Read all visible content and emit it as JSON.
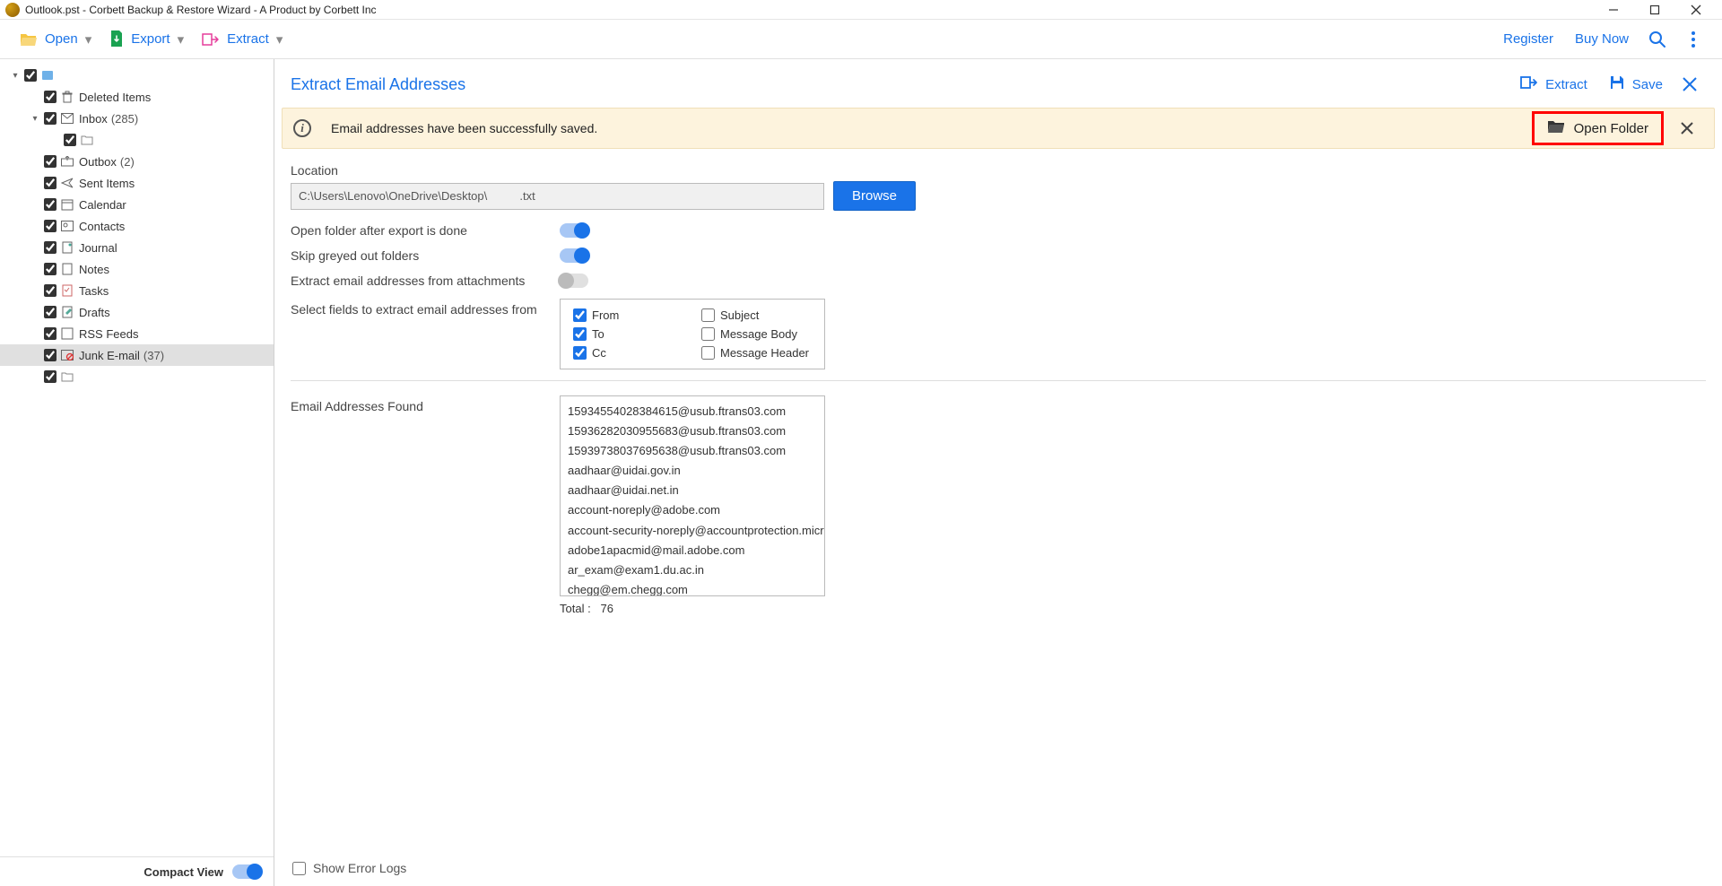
{
  "titlebar": {
    "title": "Outlook.pst - Corbett Backup & Restore Wizard - A Product by Corbett Inc"
  },
  "toolbar": {
    "open": "Open",
    "export": "Export",
    "extract": "Extract",
    "register": "Register",
    "buy_now": "Buy Now"
  },
  "tree": {
    "root_label": "",
    "items": [
      {
        "level": 0,
        "expand": "▾",
        "checked": true,
        "icon": "pst",
        "label": "",
        "count": ""
      },
      {
        "level": 1,
        "expand": "",
        "checked": true,
        "icon": "trash",
        "label": "Deleted Items",
        "count": ""
      },
      {
        "level": 1,
        "expand": "▾",
        "checked": true,
        "icon": "mail",
        "label": "Inbox",
        "count": "(285)"
      },
      {
        "level": 2,
        "expand": "",
        "checked": true,
        "icon": "folder",
        "label": "",
        "count": ""
      },
      {
        "level": 1,
        "expand": "",
        "checked": true,
        "icon": "outbox",
        "label": "Outbox",
        "count": "(2)"
      },
      {
        "level": 1,
        "expand": "",
        "checked": true,
        "icon": "sent",
        "label": "Sent Items",
        "count": ""
      },
      {
        "level": 1,
        "expand": "",
        "checked": true,
        "icon": "calendar",
        "label": "Calendar",
        "count": ""
      },
      {
        "level": 1,
        "expand": "",
        "checked": true,
        "icon": "contacts",
        "label": "Contacts",
        "count": ""
      },
      {
        "level": 1,
        "expand": "",
        "checked": true,
        "icon": "journal",
        "label": "Journal",
        "count": ""
      },
      {
        "level": 1,
        "expand": "",
        "checked": true,
        "icon": "notes",
        "label": "Notes",
        "count": ""
      },
      {
        "level": 1,
        "expand": "",
        "checked": true,
        "icon": "tasks",
        "label": "Tasks",
        "count": ""
      },
      {
        "level": 1,
        "expand": "",
        "checked": true,
        "icon": "drafts",
        "label": "Drafts",
        "count": ""
      },
      {
        "level": 1,
        "expand": "",
        "checked": true,
        "icon": "rss",
        "label": "RSS Feeds",
        "count": ""
      },
      {
        "level": 1,
        "expand": "",
        "checked": true,
        "icon": "junk",
        "label": "Junk E-mail",
        "count": "(37)",
        "selected": true
      },
      {
        "level": 1,
        "expand": "",
        "checked": true,
        "icon": "folder",
        "label": "",
        "count": ""
      }
    ],
    "compact_view": "Compact View"
  },
  "content": {
    "title": "Extract Email Addresses",
    "extract_label": "Extract",
    "save_label": "Save",
    "notif_text": "Email addresses have been successfully saved.",
    "open_folder": "Open Folder",
    "location_label": "Location",
    "location_value": "C:\\Users\\Lenovo\\OneDrive\\Desktop\\          .txt",
    "browse": "Browse",
    "opt1": "Open folder after export is done",
    "opt2": "Skip greyed out folders",
    "opt3": "Extract email addresses from attachments",
    "fields_label": "Select fields to extract email addresses from",
    "fields": [
      {
        "label": "From",
        "checked": true
      },
      {
        "label": "Subject",
        "checked": false
      },
      {
        "label": "To",
        "checked": true
      },
      {
        "label": "Message Body",
        "checked": false
      },
      {
        "label": "Cc",
        "checked": true
      },
      {
        "label": "Message Header",
        "checked": false
      }
    ],
    "found_label": "Email Addresses Found",
    "emails": [
      "15934554028384615@usub.ftrans03.com",
      "15936282030955683@usub.ftrans03.com",
      "15939738037695638@usub.ftrans03.com",
      "aadhaar@uidai.gov.in",
      "aadhaar@uidai.net.in",
      "account-noreply@adobe.com",
      "account-security-noreply@accountprotection.micro",
      "adobe1apacmid@mail.adobe.com",
      "ar_exam@exam1.du.ac.in",
      "chegg@em.chegg.com"
    ],
    "total_label": "Total :",
    "total_value": "76",
    "error_logs": "Show Error Logs"
  }
}
